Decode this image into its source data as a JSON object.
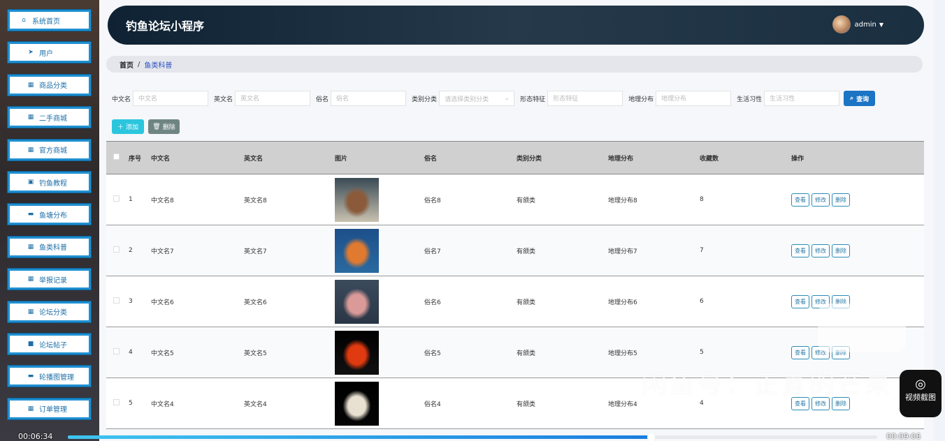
{
  "app": {
    "title": "钓鱼论坛小程序",
    "user": "admin"
  },
  "sidebar": {
    "items": [
      {
        "label": "系统首页",
        "icon": "home-icon",
        "glyph": "⌂"
      },
      {
        "label": "用户",
        "icon": "send-icon",
        "glyph": "➤"
      },
      {
        "label": "商品分类",
        "icon": "grid-icon",
        "glyph": "▦"
      },
      {
        "label": "二手商城",
        "icon": "grid-icon",
        "glyph": "▦"
      },
      {
        "label": "官方商城",
        "icon": "grid-icon",
        "glyph": "▦"
      },
      {
        "label": "钓鱼教程",
        "icon": "clipboard-icon",
        "glyph": "▣"
      },
      {
        "label": "鱼塘分布",
        "icon": "monitor-icon",
        "glyph": "▬"
      },
      {
        "label": "鱼类科普",
        "icon": "grid-icon",
        "glyph": "▦"
      },
      {
        "label": "举报记录",
        "icon": "grid-icon",
        "glyph": "▦"
      },
      {
        "label": "论坛分类",
        "icon": "grid-icon",
        "glyph": "▦"
      },
      {
        "label": "论坛帖子",
        "icon": "video-icon",
        "glyph": "■"
      },
      {
        "label": "轮播图管理",
        "icon": "monitor-icon",
        "glyph": "▬"
      },
      {
        "label": "订单管理",
        "icon": "grid-icon",
        "glyph": "▦"
      }
    ]
  },
  "breadcrumb": {
    "home": "首页",
    "sep": "/",
    "current": "鱼类科普"
  },
  "search": {
    "fields": [
      {
        "label": "中文名",
        "placeholder": "中文名"
      },
      {
        "label": "英文名",
        "placeholder": "英文名"
      },
      {
        "label": "俗名",
        "placeholder": "俗名"
      }
    ],
    "category": {
      "label": "类别分类",
      "placeholder": "请选择类别分类"
    },
    "fields2": [
      {
        "label": "形态特征",
        "placeholder": "形态特征"
      },
      {
        "label": "地理分布",
        "placeholder": "地理分布"
      },
      {
        "label": "生活习性",
        "placeholder": "生活习性"
      }
    ],
    "query": "查询"
  },
  "toolbar": {
    "add": "添加",
    "delete": "删除"
  },
  "table": {
    "headers": [
      "序号",
      "中文名",
      "英文名",
      "图片",
      "俗名",
      "类别分类",
      "地理分布",
      "收藏数",
      "操作"
    ],
    "rows": [
      {
        "no": "1",
        "cn": "中文名8",
        "en": "英文名8",
        "common": "俗名8",
        "cat": "有颌类",
        "geo": "地理分布8",
        "fav": "8",
        "img": [
          "#3a4a55",
          "#8a5a3a",
          "#c9c2b0"
        ]
      },
      {
        "no": "2",
        "cn": "中文名7",
        "en": "英文名7",
        "common": "俗名7",
        "cat": "有颌类",
        "geo": "地理分布7",
        "fav": "7",
        "img": [
          "#1d4f8a",
          "#e07a30",
          "#2a6aa0"
        ]
      },
      {
        "no": "3",
        "cn": "中文名6",
        "en": "英文名6",
        "common": "俗名6",
        "cat": "有颌类",
        "geo": "地理分布6",
        "fav": "6",
        "img": [
          "#3b4b5c",
          "#d99a98",
          "#2a3646"
        ]
      },
      {
        "no": "4",
        "cn": "中文名5",
        "en": "英文名5",
        "common": "俗名5",
        "cat": "有颌类",
        "geo": "地理分布5",
        "fav": "5",
        "img": [
          "#000000",
          "#e03a10",
          "#111111"
        ]
      },
      {
        "no": "5",
        "cn": "中文名4",
        "en": "英文名4",
        "common": "俗名4",
        "cat": "有颌类",
        "geo": "地理分布4",
        "fav": "4",
        "img": [
          "#000000",
          "#e8e0d0",
          "#050505"
        ]
      }
    ],
    "actions": {
      "view": "查看",
      "edit": "修改",
      "delete": "删除"
    }
  },
  "overlay": {
    "watermark": "闲鱼号：正直的芒果",
    "screenshot": "视频截图",
    "logo": "闲鱼"
  },
  "player": {
    "current": "00:06:34",
    "total": "00:09:06",
    "progress": 0.72
  }
}
